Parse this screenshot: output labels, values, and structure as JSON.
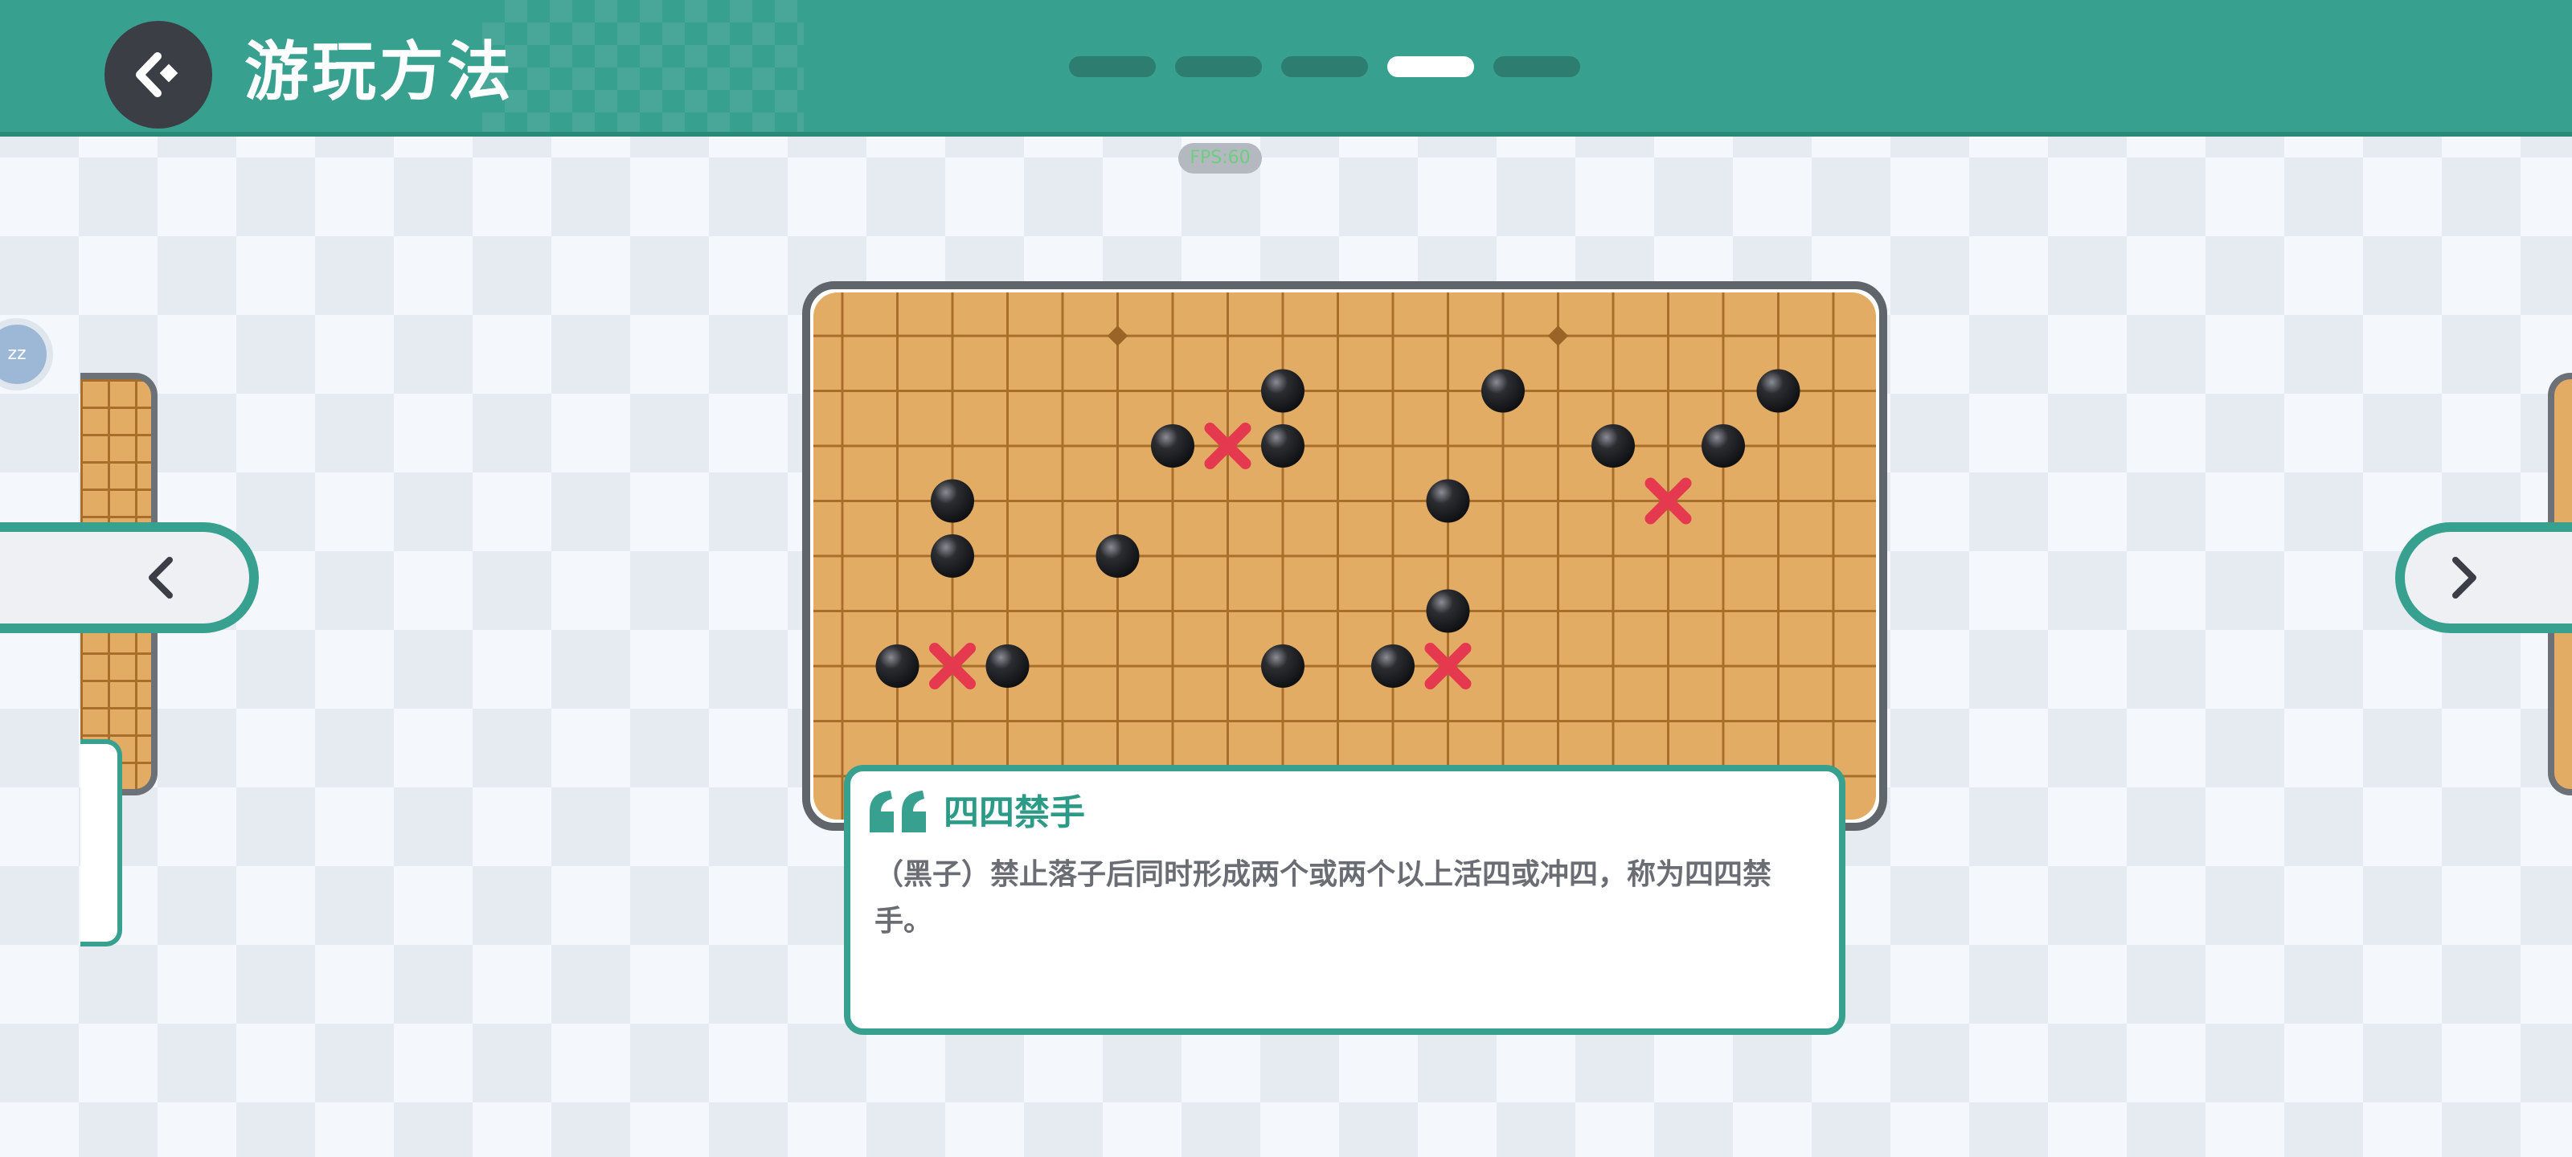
{
  "header": {
    "title": "游玩方法",
    "back_icon": "back-arrow-icon",
    "page_indicator": {
      "total": 5,
      "active": 4
    }
  },
  "fps_badge": "FPS:60",
  "left_peek": {
    "avatar_text": "zz"
  },
  "nav": {
    "prev_icon": "chevron-left-icon",
    "next_icon": "chevron-right-icon"
  },
  "board": {
    "grid_cols": 20,
    "grid_rows": 9,
    "star_points": [
      [
        5,
        0
      ],
      [
        13,
        0
      ]
    ],
    "black_stones": [
      [
        8,
        1
      ],
      [
        12,
        1
      ],
      [
        17,
        1
      ],
      [
        6,
        2
      ],
      [
        8,
        2
      ],
      [
        14,
        2
      ],
      [
        16,
        2
      ],
      [
        2,
        3
      ],
      [
        11,
        3
      ],
      [
        2,
        4
      ],
      [
        5,
        4
      ],
      [
        11,
        5
      ],
      [
        1,
        6
      ],
      [
        3,
        6
      ],
      [
        8,
        6
      ],
      [
        10,
        6
      ]
    ],
    "forbidden_marks": [
      [
        7,
        2
      ],
      [
        15,
        3
      ],
      [
        2,
        6
      ],
      [
        11,
        6
      ]
    ],
    "colors": {
      "wood": "#e3ac65",
      "line": "#a86f2c",
      "mark": "#e53950"
    }
  },
  "description": {
    "title": "四四禁手",
    "text": "（黑子）禁止落子后同时形成两个或两个以上活四或冲四，称为四四禁手。"
  },
  "colors": {
    "accent": "#38a08f",
    "dark": "#3b3e45"
  }
}
